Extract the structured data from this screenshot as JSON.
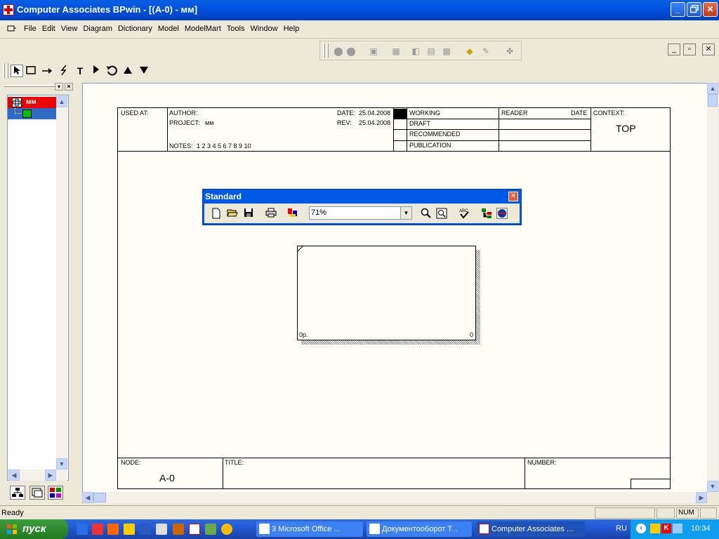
{
  "window": {
    "title": "Computer Associates BPwin - [(A-0)  - мм]",
    "min_label": "_",
    "max_label": "□",
    "close_label": "✕"
  },
  "menu": [
    "File",
    "Edit",
    "View",
    "Diagram",
    "Dictionary",
    "Model",
    "ModelMart",
    "Tools",
    "Window",
    "Help"
  ],
  "mdi": {
    "min_label": "_",
    "restore_label": "▫",
    "close_label": "✕"
  },
  "toolbox": [
    "pointer",
    "box",
    "arrow",
    "squiggle",
    "T",
    "play",
    "undo",
    "up",
    "down"
  ],
  "tree": {
    "root_label": "мм"
  },
  "frame": {
    "used_at": "USED AT:",
    "author": "AUTHOR:",
    "project": "PROJECT:",
    "project_value": "мм",
    "date_label": "DATE:",
    "date_value": "25.04.2008",
    "rev_label": "REV:",
    "rev_value": "25.04.2008",
    "notes_label": "NOTES:",
    "notes_value": "1  2  3  4  5  6  7  8  9  10",
    "status": [
      "WORKING",
      "DRAFT",
      "RECOMMENDED",
      "PUBLICATION"
    ],
    "reader": "READER",
    "date2": "DATE",
    "context": "CONTEXT:",
    "context_value": "TOP",
    "node_label": "NODE:",
    "node_value": "A-0",
    "title_label": "TITLE:",
    "number_label": "NUMBER:"
  },
  "activity": {
    "cost": "0р.",
    "number": "0"
  },
  "standard_toolbar": {
    "title": "Standard",
    "zoom": "71%"
  },
  "status": {
    "text": "Ready",
    "num": "NUM"
  },
  "taskbar": {
    "start": "пуск",
    "tasks": [
      "3 Microsoft Office ...",
      "Документооборот Т...",
      "Computer Associates ..."
    ],
    "lang": "RU",
    "clock": "10:34"
  }
}
